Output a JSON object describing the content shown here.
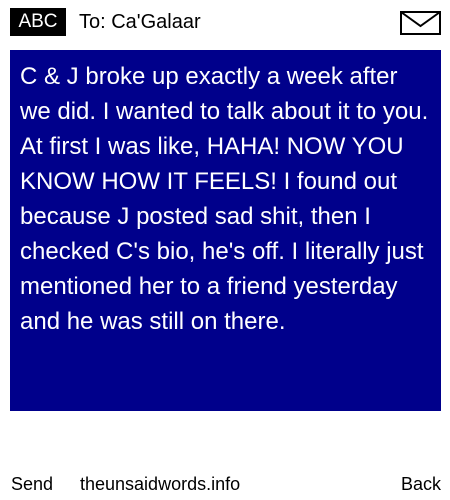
{
  "header": {
    "mode_label": "ABC",
    "to_line": "To: Ca'Galaar",
    "icon": "envelope-icon"
  },
  "message": {
    "body": "C & J broke up exactly a week after we did. I wanted to talk about it to you. At first I was like, HAHA! NOW YOU KNOW HOW IT FEELS! I found out because J posted sad shit, then I checked C's bio, he's off. I literally just mentioned her to a friend yesterday and he was still on there."
  },
  "footer": {
    "send_label": "Send",
    "site_label": "theunsaidwords.info",
    "back_label": "Back"
  },
  "colors": {
    "message_background": "#00008b",
    "message_text": "#ffffff",
    "badge_background": "#000000"
  }
}
